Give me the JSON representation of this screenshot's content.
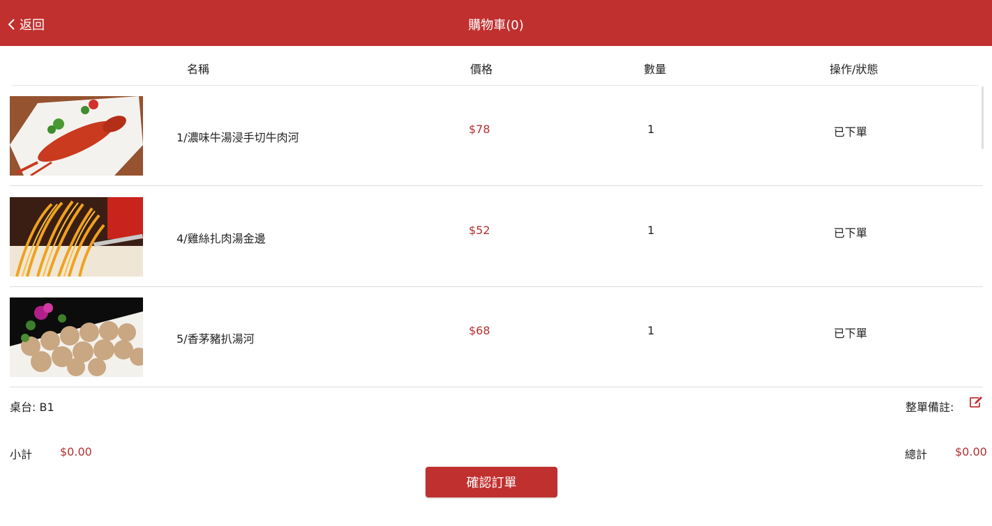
{
  "header": {
    "back_label": "返回",
    "title": "購物車(0)"
  },
  "columns": [
    "名稱",
    "價格",
    "數量",
    "操作/狀態"
  ],
  "items": [
    {
      "name": "1/濃味牛湯浸手切牛肉河",
      "price": "$78",
      "qty": "1",
      "status": "已下單",
      "image": "lobster-dish"
    },
    {
      "name": "4/雞絲扎肉湯金邊",
      "price": "$52",
      "qty": "1",
      "status": "已下單",
      "image": "noodles-dish"
    },
    {
      "name": "5/香茅豬扒湯河",
      "price": "$68",
      "qty": "1",
      "status": "已下單",
      "image": "meatballs-dish"
    }
  ],
  "footer": {
    "table_label": "桌台: B1",
    "remark_label": "整單備註:",
    "subtotal_label": "小計",
    "subtotal_value": "$0.00",
    "total_label": "總計",
    "total_value": "$0.00",
    "confirm_label": "確認訂單"
  },
  "colors": {
    "brand": "#c0302f",
    "price": "#b3302f"
  }
}
